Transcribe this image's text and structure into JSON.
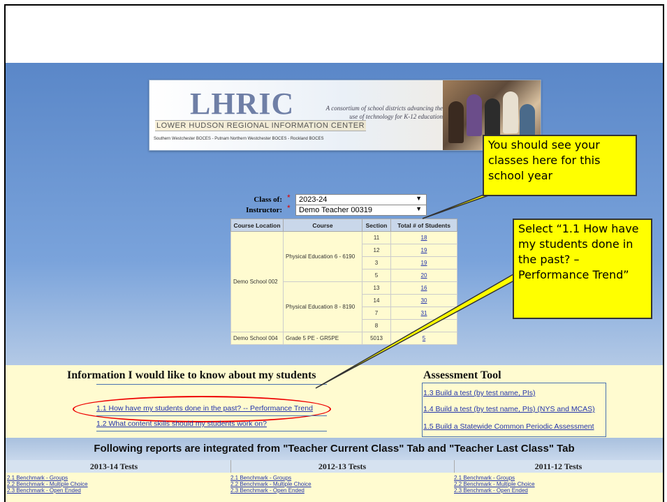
{
  "banner": {
    "logo": "LHRIC",
    "logo_sub": "LOWER HUDSON REGIONAL INFORMATION CENTER",
    "boces": "Southern Westchester BOCES - Putnam Northern Westchester BOCES - Rockland BOCES",
    "tagline": "A consortium of school districts advancing the use of technology for K-12 education"
  },
  "filters": {
    "class_of_label": "Class of:",
    "class_of_value": "2023-24",
    "instructor_label": "Instructor:",
    "instructor_value": "Demo Teacher 00319"
  },
  "class_table": {
    "headers": [
      "Course Location",
      "Course",
      "Section",
      "Total # of Students"
    ],
    "location_1": "Demo School 002",
    "course_1": "Physical Education 6 - 6190",
    "course_2": "Physical Education 8 - 8190",
    "location_2": "Demo School 004",
    "course_3": "Grade 5 PE - GR5PE",
    "rows": [
      {
        "section": "11",
        "total": "18"
      },
      {
        "section": "12",
        "total": "19"
      },
      {
        "section": "3",
        "total": "19"
      },
      {
        "section": "5",
        "total": "20"
      },
      {
        "section": "13",
        "total": "16"
      },
      {
        "section": "14",
        "total": "30"
      },
      {
        "section": "7",
        "total": "31"
      },
      {
        "section": "8",
        "total": ""
      },
      {
        "section": "5013",
        "total": "5"
      }
    ]
  },
  "callouts": {
    "classes": "You should see your classes here for this school year",
    "select": "Select “1.1 How have my students done in the past? – Performance Trend”"
  },
  "info": {
    "title": "Information I would like to know about my students",
    "link_1_1": "1.1 How have my students done in the past? -- Performance Trend",
    "link_1_2": "1.2 What content skills should my students work on?"
  },
  "assessment": {
    "title": "Assessment Tool",
    "link_1_3": "1.3 Build a test (by test name, PIs)",
    "link_1_4": "1.4 Build a test (by test name, PIs) (NYS and MCAS)",
    "link_1_5": "1.5 Build a Statewide Common Periodic Assessment"
  },
  "reports": {
    "banner": "Following reports are integrated from \"Teacher Current Class\" Tab and \"Teacher Last Class\" Tab",
    "years": [
      "2013-14 Tests",
      "2012-13 Tests",
      "2011-12 Tests"
    ],
    "links": [
      "2.1 Benchmark - Groups",
      "2.2 Benchmark - Multiple Choice",
      "2.3 Benchmark - Open Ended"
    ]
  },
  "colors": {
    "callout": "#ffff00",
    "highlight_oval": "#e00000",
    "link": "#2233aa",
    "panel_bg": "#fffbd0"
  }
}
